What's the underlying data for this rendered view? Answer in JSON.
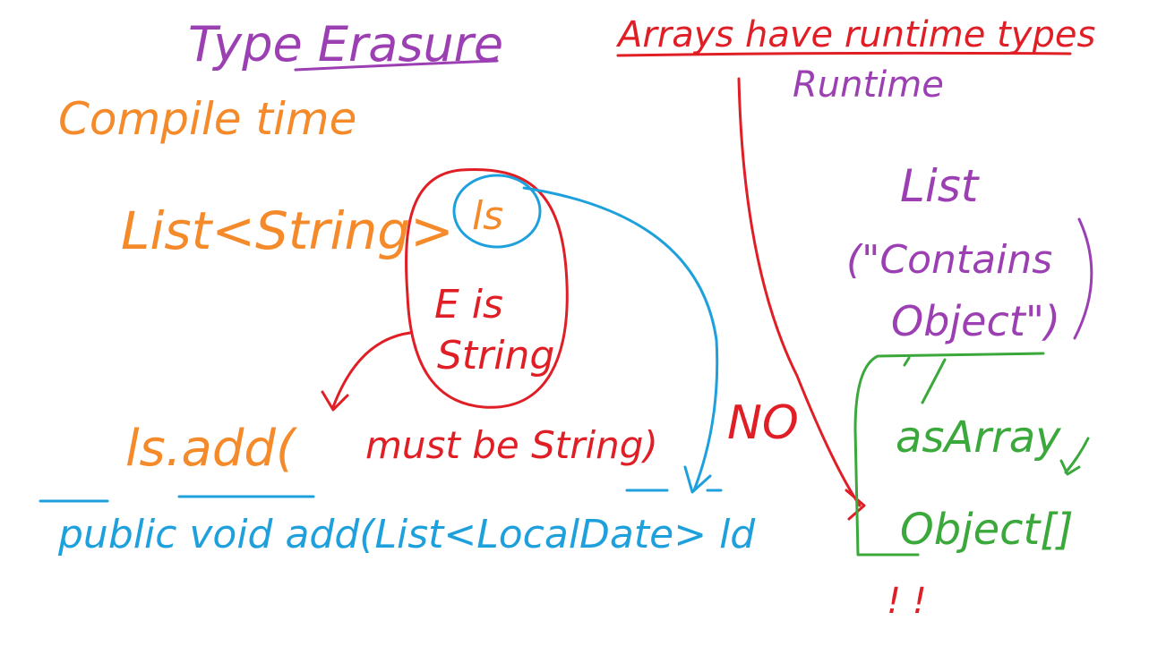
{
  "title": "Type Erasure",
  "arrays_note": "Arrays have runtime types",
  "runtime_label": "Runtime",
  "compile_time_label": "Compile time",
  "list_string": "List<String>",
  "ls_variable": "ls",
  "e_is": "E is",
  "e_string": "String",
  "ls_add": "ls.add(",
  "must_be_string": "must be String)",
  "no_label": "NO",
  "list_label": "List",
  "contains_object": "(\"Contains",
  "object_word": "Object\")",
  "as_array": "asArray",
  "object_array": "Object[]",
  "exclamation": "! !",
  "method_signature": "public void add(List<LocalDate> ld",
  "colors": {
    "purple": "#9b3fb3",
    "orange": "#f58a2a",
    "red": "#e01e26",
    "blue": "#1ea0dc",
    "green": "#3aa83a"
  }
}
